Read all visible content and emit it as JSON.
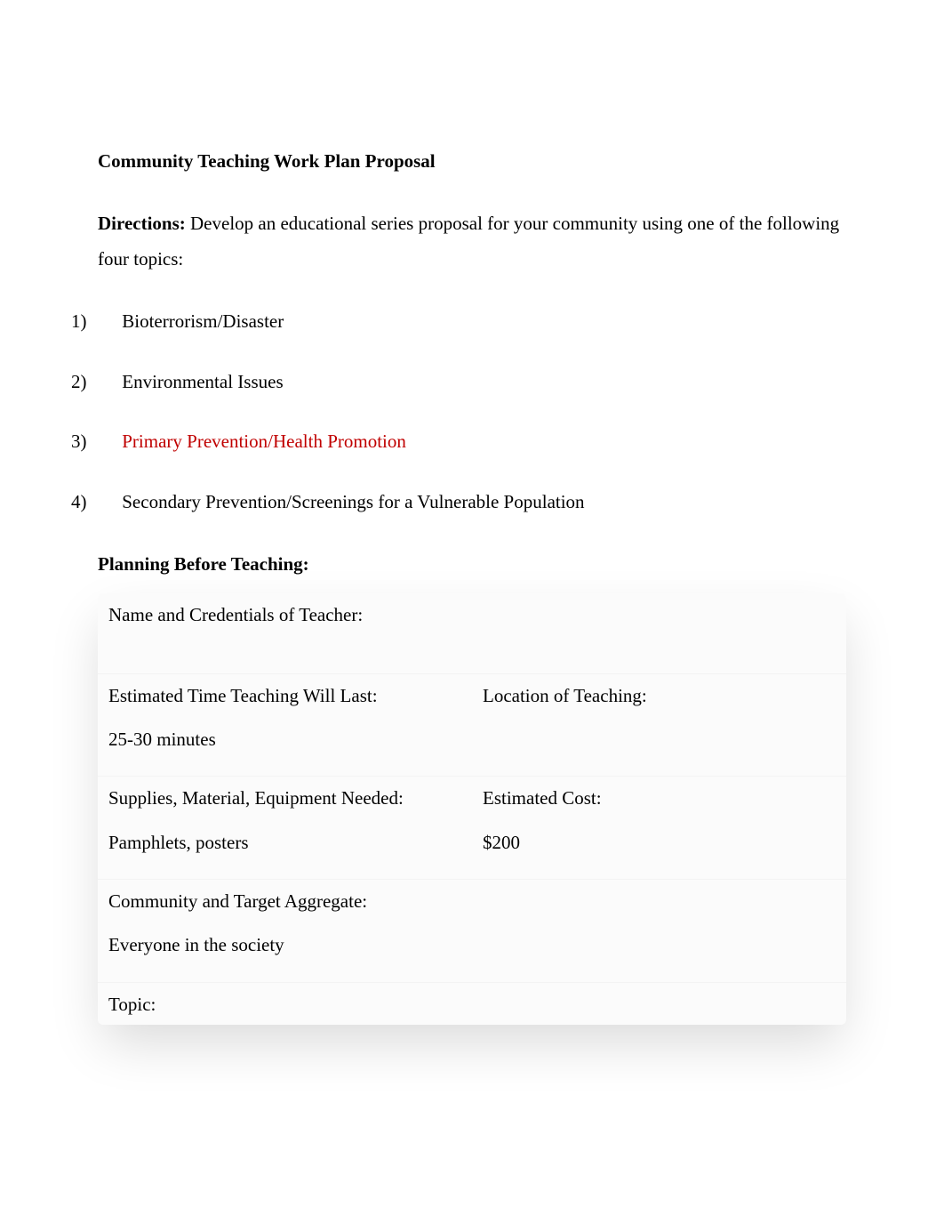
{
  "title": "Community Teaching Work Plan Proposal",
  "directions": {
    "label": "Directions: ",
    "text": "Develop an educational series proposal for your community using one of the following four topics:"
  },
  "list": [
    {
      "num": "1)",
      "text": "Bioterrorism/Disaster",
      "red": false
    },
    {
      "num": "2)",
      "text": "Environmental Issues",
      "red": false
    },
    {
      "num": "3)",
      "text": "Primary Prevention/Health Promotion",
      "red": true
    },
    {
      "num": "4)",
      "text": "Secondary Prevention/Screenings for a Vulnerable Population",
      "red": false
    }
  ],
  "planning_heading": "Planning Before Teaching:",
  "table": {
    "row1_label": "Name and Credentials of Teacher:",
    "row2_left_label": "Estimated Time Teaching Will Last:",
    "row2_left_value": "25-30 minutes",
    "row2_right_label": "Location of Teaching:",
    "row2_right_value": "",
    "row3_left_label": "Supplies, Material, Equipment Needed:",
    "row3_left_value": "Pamphlets, posters",
    "row3_right_label": "Estimated Cost:",
    "row3_right_value": "$200",
    "row4_label": "Community and Target Aggregate:",
    "row4_value": "Everyone in the society",
    "row5_label": "Topic:"
  }
}
